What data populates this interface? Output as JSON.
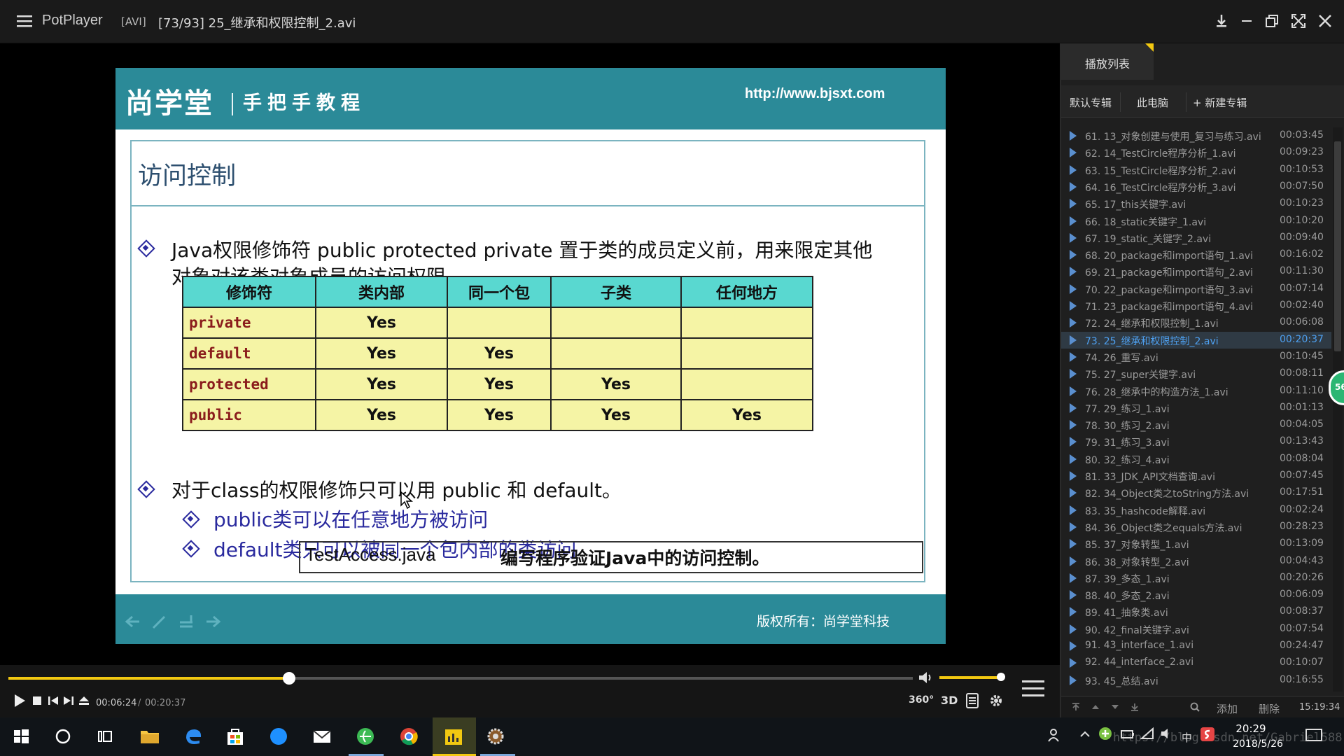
{
  "titlebar": {
    "app_name": "PotPlayer",
    "format": "[AVI]",
    "file_title": "[73/93] 25_继承和权限控制_2.avi"
  },
  "slide": {
    "logo": "尚学堂",
    "slogan": "手把手教程",
    "url": "http://www.bjsxt.com",
    "heading": "访问控制",
    "bullet1_line1": "Java权限修饰符 public protected private 置于类的成员定义前，用来限定其他",
    "bullet1_line2": "对象对该类对象成员的访问权限。",
    "table": {
      "headers": [
        "修饰符",
        "类内部",
        "同一个包",
        "子类",
        "任何地方"
      ],
      "rows": [
        [
          "private",
          "Yes",
          "",
          "",
          ""
        ],
        [
          "default",
          "Yes",
          "Yes",
          "",
          ""
        ],
        [
          "protected",
          "Yes",
          "Yes",
          "Yes",
          ""
        ],
        [
          "public",
          "Yes",
          "Yes",
          "Yes",
          "Yes"
        ]
      ]
    },
    "bullet2": "对于class的权限修饰只可以用 public 和 default。",
    "sub1": "public类可以在任意地方被访问",
    "sub2": "default类只可以被同一个包内部的类访问",
    "note_left": "TestAccess.java",
    "note_right": "编写程序验证Java中的访问控制。",
    "copyright": "版权所有：尚学堂科技"
  },
  "playlist": {
    "tab": "播放列表",
    "albums": [
      "默认专辑",
      "此电脑",
      "+ 新建专辑"
    ],
    "items": [
      {
        "name": "61. 13_对象创建与使用_复习与练习.avi",
        "dur": "00:03:45"
      },
      {
        "name": "62. 14_TestCircle程序分析_1.avi",
        "dur": "00:09:23"
      },
      {
        "name": "63. 15_TestCircle程序分析_2.avi",
        "dur": "00:10:53"
      },
      {
        "name": "64. 16_TestCircle程序分析_3.avi",
        "dur": "00:07:50"
      },
      {
        "name": "65. 17_this关键字.avi",
        "dur": "00:10:23"
      },
      {
        "name": "66. 18_static关键字_1.avi",
        "dur": "00:10:20"
      },
      {
        "name": "67. 19_static_关键字_2.avi",
        "dur": "00:09:40"
      },
      {
        "name": "68. 20_package和import语句_1.avi",
        "dur": "00:16:02"
      },
      {
        "name": "69. 21_package和import语句_2.avi",
        "dur": "00:11:30"
      },
      {
        "name": "70. 22_package和import语句_3.avi",
        "dur": "00:07:14"
      },
      {
        "name": "71. 23_package和import语句_4.avi",
        "dur": "00:02:40"
      },
      {
        "name": "72. 24_继承和权限控制_1.avi",
        "dur": "00:06:08"
      },
      {
        "name": "73. 25_继承和权限控制_2.avi",
        "dur": "00:20:37"
      },
      {
        "name": "74. 26_重写.avi",
        "dur": "00:10:45"
      },
      {
        "name": "75. 27_super关键字.avi",
        "dur": "00:08:11"
      },
      {
        "name": "76. 28_继承中的构造方法_1.avi",
        "dur": "00:11:10"
      },
      {
        "name": "77. 29_练习_1.avi",
        "dur": "00:01:13"
      },
      {
        "name": "78. 30_练习_2.avi",
        "dur": "00:04:05"
      },
      {
        "name": "79. 31_练习_3.avi",
        "dur": "00:13:43"
      },
      {
        "name": "80. 32_练习_4.avi",
        "dur": "00:08:04"
      },
      {
        "name": "81. 33_JDK_API文档查询.avi",
        "dur": "00:07:45"
      },
      {
        "name": "82. 34_Object类之toString方法.avi",
        "dur": "00:17:51"
      },
      {
        "name": "83. 35_hashcode解释.avi",
        "dur": "00:02:24"
      },
      {
        "name": "84. 36_Object类之equals方法.avi",
        "dur": "00:28:23"
      },
      {
        "name": "85. 37_对象转型_1.avi",
        "dur": "00:13:09"
      },
      {
        "name": "86. 38_对象转型_2.avi",
        "dur": "00:04:43"
      },
      {
        "name": "87. 39_多态_1.avi",
        "dur": "00:20:26"
      },
      {
        "name": "88. 40_多态_2.avi",
        "dur": "00:06:09"
      },
      {
        "name": "89. 41_抽象类.avi",
        "dur": "00:08:37"
      },
      {
        "name": "90. 42_final关键字.avi",
        "dur": "00:07:54"
      },
      {
        "name": "91. 43_interface_1.avi",
        "dur": "00:24:47"
      },
      {
        "name": "92. 44_interface_2.avi",
        "dur": "00:10:07"
      },
      {
        "name": "93. 45_总结.avi",
        "dur": "00:16:55"
      }
    ],
    "active_index": 12,
    "bottom_add": "添加",
    "bottom_delete": "删除",
    "bottom_time": "15:19:34",
    "badge": "56"
  },
  "controls": {
    "current_time": "00:06:24",
    "separator": "/",
    "total_time": "00:20:37",
    "progress": 0.31,
    "volume": 1.0,
    "btn_360": "360°",
    "btn_3d": "3D"
  },
  "taskbar": {
    "time": "20:29",
    "date": "2018/5/26",
    "ime": "中",
    "watermark": "https://blog.csdn.net/Gabriel588"
  },
  "colors": {
    "accent": "#f2c811",
    "slide_teal": "#2b8a98",
    "table_header": "#59d8d0",
    "table_cell": "#f5f4a5",
    "playlist_active": "#4ea0f0"
  }
}
